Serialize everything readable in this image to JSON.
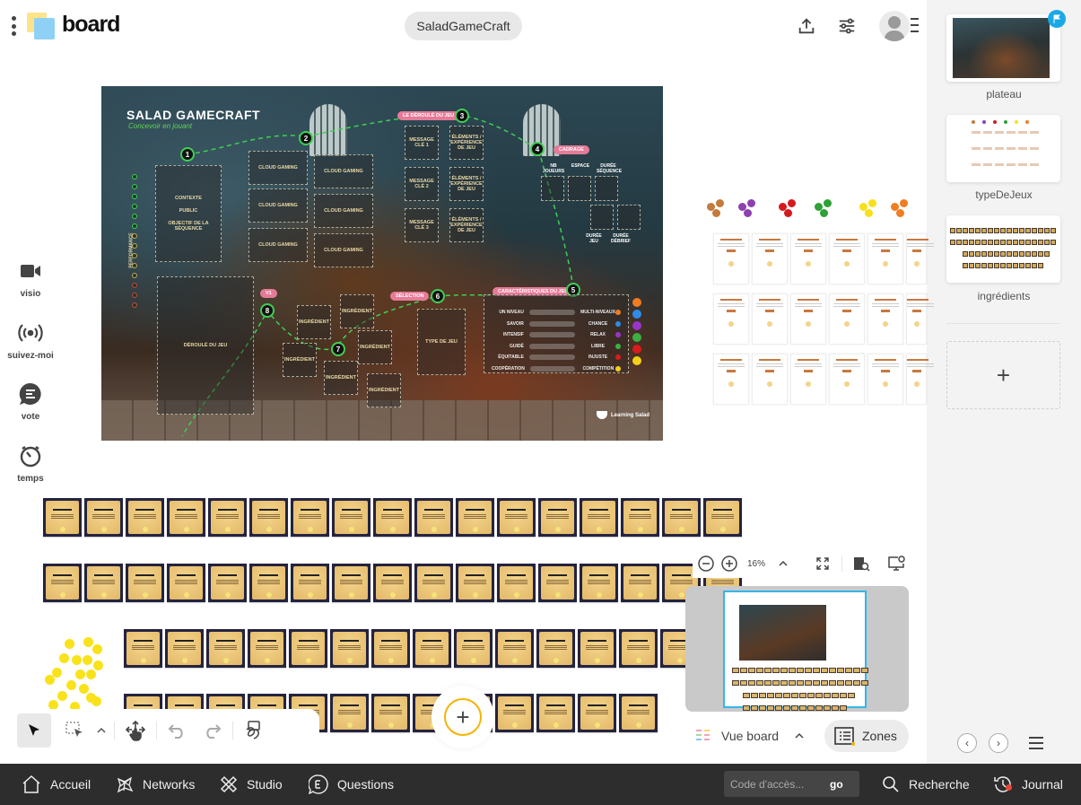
{
  "header": {
    "logo_text": "board",
    "board_title": "SaladGameCraft",
    "icons": [
      "menu-dots-icon",
      "share-upload-icon",
      "settings-sliders-icon",
      "avatar-icon",
      "avatar-menu-icon"
    ]
  },
  "side_tools": [
    {
      "label": "visio",
      "icon": "video-camera-icon"
    },
    {
      "label": "suivez-moi",
      "icon": "broadcast-icon"
    },
    {
      "label": "vote",
      "icon": "vote-bubble-icon"
    },
    {
      "label": "temps",
      "icon": "stopwatch-icon"
    }
  ],
  "plateau": {
    "title": "SALAD GAMECRAFT",
    "subtitle": "Concevoir en jouant",
    "side_label": "Performance",
    "step_numbers": [
      "1",
      "2",
      "3",
      "4",
      "5",
      "6",
      "7",
      "8"
    ],
    "zone1": [
      "Contexte",
      "Public",
      "Objectif de la séquence"
    ],
    "cloud_gaming": "Cloud gaming",
    "deroule": "Déroulé du jeu",
    "design_label": "Le déroulé du jeu",
    "message_keys": [
      "Message clé 1",
      "Message clé 2",
      "Message clé 3"
    ],
    "elements": "Éléments / expérience de jeu",
    "cadrage_label": "Cadrage",
    "cadrage": [
      "Nb joueurs",
      "Espace",
      "Durée séquence",
      "Durée jeu",
      "Durée débrief"
    ],
    "selection_label": "Sélection",
    "type_de_jeu": "Type de jeu",
    "v1_label": "V1",
    "ingredient": "Ingrédient",
    "carac_title": "Caractéristiques du jeu",
    "carac_rows": [
      {
        "left": "Un niveau",
        "right": "Multi-niveaux",
        "color": "#f07c24"
      },
      {
        "left": "Savoir",
        "right": "Chance",
        "color": "#2e8ce8"
      },
      {
        "left": "Intensif",
        "right": "Relax",
        "color": "#9a35c9"
      },
      {
        "left": "Guidé",
        "right": "Libre",
        "color": "#3cb043"
      },
      {
        "left": "Équitable",
        "right": "Injuste",
        "color": "#d91c1c"
      },
      {
        "left": "Coopération",
        "right": "Compétition",
        "color": "#f2d01a"
      }
    ],
    "brand": "Learning Salad"
  },
  "token_colors": [
    "#c47a3c",
    "#8e3fb0",
    "#d5191c",
    "#2ea236",
    "#f7e01a",
    "#f07d20"
  ],
  "ingredient_rows": [
    17,
    17,
    14,
    13
  ],
  "toolbar": {
    "tools": [
      "select-arrow-icon",
      "lasso-select-icon",
      "chevron-up-icon",
      "pan-hand-icon",
      "undo-icon",
      "redo-icon",
      "ink-draw-icon"
    ],
    "add_label": "+"
  },
  "zoom": {
    "level": "16%",
    "icons": [
      "zoom-out-icon",
      "zoom-in-icon",
      "chevron-up-icon",
      "fit-screen-icon",
      "search-page-icon",
      "screen-settings-icon"
    ]
  },
  "view": {
    "vue_board": "Vue board",
    "zones": "Zones"
  },
  "slides": [
    {
      "label": "plateau",
      "active": true
    },
    {
      "label": "typeDeJeux",
      "active": false
    },
    {
      "label": "ingrédients",
      "active": false
    }
  ],
  "slides_nav": {
    "add": "+",
    "prev": "‹",
    "next": "›"
  },
  "bottom_nav": {
    "items": [
      {
        "label": "Accueil",
        "icon": "home-icon"
      },
      {
        "label": "Networks",
        "icon": "network-icon"
      },
      {
        "label": "Studio",
        "icon": "studio-tools-icon"
      },
      {
        "label": "Questions",
        "icon": "questions-bubble-icon"
      }
    ],
    "access_placeholder": "Code d'accès...",
    "access_value": "",
    "go_label": "go",
    "search_label": "Recherche",
    "journal_label": "Journal"
  }
}
